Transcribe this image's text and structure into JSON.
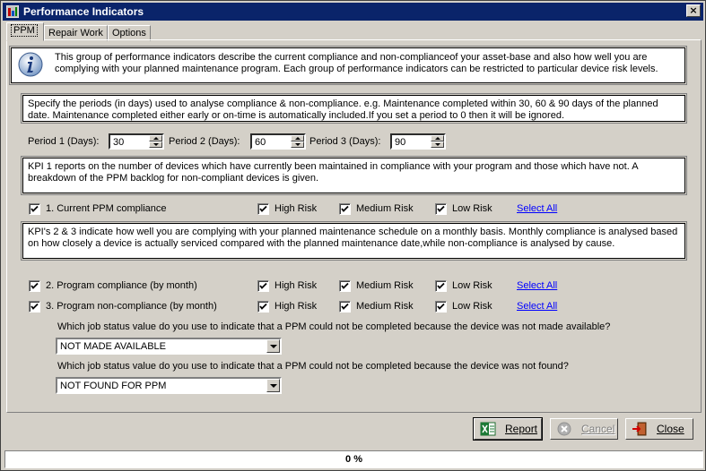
{
  "window": {
    "title": "Performance Indicators",
    "close_glyph": "×"
  },
  "tabs": [
    {
      "label": "PPM",
      "active": true
    },
    {
      "label": "Repair Work",
      "active": false
    },
    {
      "label": "Options",
      "active": false
    }
  ],
  "intro": {
    "icon": "info-icon",
    "text": "This group of performance indicators describe the current compliance and non-complianceof your asset-base and also how well you are complying with your planned maintenance program. Each group of performance indicators can be restricted to particular device risk levels."
  },
  "periods_help": "Specify the periods (in days) used to analyse compliance & non-compliance. e.g. Maintenance completed within 30, 60 & 90 days of the planned date. Maintenance completed either early or on-time is automatically included.If you set a period to 0 then it will be ignored.",
  "periods": [
    {
      "label": "Period 1 (Days):",
      "value": "30"
    },
    {
      "label": "Period 2 (Days):",
      "value": "60"
    },
    {
      "label": "Period 3 (Days):",
      "value": "90"
    }
  ],
  "kpi1_help": "KPI 1  reports on the number of devices which have currently been maintained in compliance with your program and those which have not. A breakdown of the PPM backlog for non-compliant devices is given.",
  "kpi23_help": "KPI's 2 & 3 indicate how well you are complying with your planned maintenance schedule on a monthly basis. Monthly compliance is analysed based on how closely a device is actually serviced compared with the planned maintenance date,while non-compliance is analysed by cause.",
  "kpis": [
    {
      "label": "1. Current PPM compliance",
      "checked": true,
      "high": "High Risk",
      "medium": "Medium Risk",
      "low": "Low Risk",
      "select_all": "Select All"
    },
    {
      "label": "2. Program compliance (by month)",
      "checked": true,
      "high": "High Risk",
      "medium": "Medium Risk",
      "low": "Low Risk",
      "select_all": "Select All"
    },
    {
      "label": "3. Program non-compliance (by month)",
      "checked": true,
      "high": "High Risk",
      "medium": "Medium Risk",
      "low": "Low Risk",
      "select_all": "Select All"
    }
  ],
  "status_questions": [
    {
      "question": "Which job status value do you use to indicate that a PPM could not be completed because the device was not made available?",
      "value": "NOT MADE AVAILABLE"
    },
    {
      "question": "Which job status value do you use to indicate that a PPM could not be completed because the device was not found?",
      "value": "NOT FOUND FOR PPM"
    }
  ],
  "buttons": {
    "report": "Report",
    "cancel": "Cancel",
    "close": "Close"
  },
  "progress": {
    "text": "0 %",
    "value": 0
  },
  "colors": {
    "titlebar": "#0a246a",
    "face": "#d4d0c8",
    "link": "#0000ff"
  }
}
